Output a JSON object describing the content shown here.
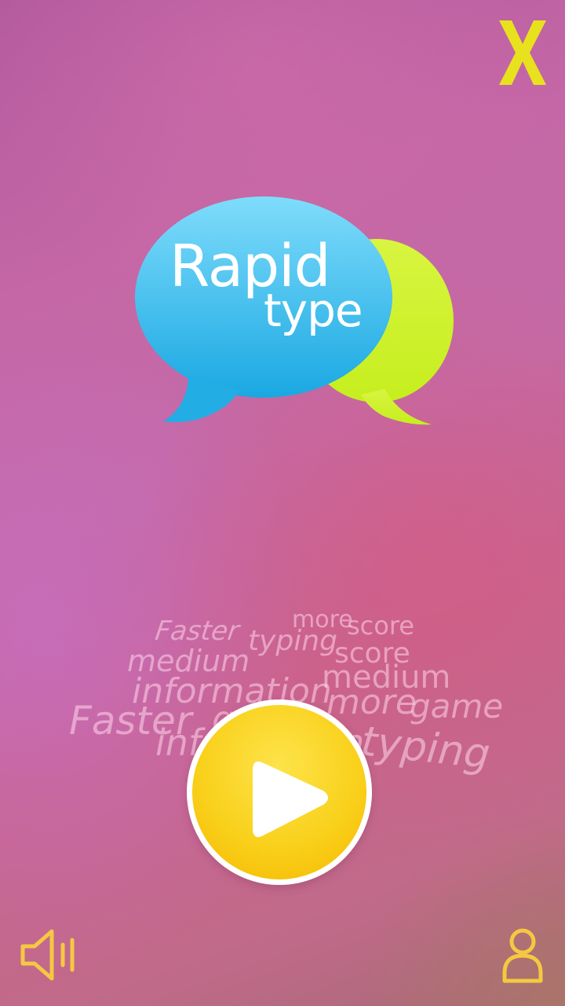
{
  "logo": {
    "line1": "Rapid",
    "line2": "type",
    "colors": {
      "blue_bubble": "#3fc4ef",
      "green_bubble": "#ccf22b"
    }
  },
  "word_cloud": {
    "words": [
      "Faster",
      "typing",
      "more",
      "score",
      "medium",
      "score",
      "medium",
      "information",
      "more",
      "game",
      "Faster",
      "game",
      "information",
      "typing"
    ]
  },
  "controls": {
    "close": {
      "icon": "close-x-icon",
      "color": "#e8e21e"
    },
    "play": {
      "icon": "play-icon",
      "color": "#f9d11c"
    },
    "sound": {
      "icon": "speaker-icon",
      "color": "#f5c842"
    },
    "profile": {
      "icon": "person-icon",
      "color": "#f5c842"
    }
  }
}
